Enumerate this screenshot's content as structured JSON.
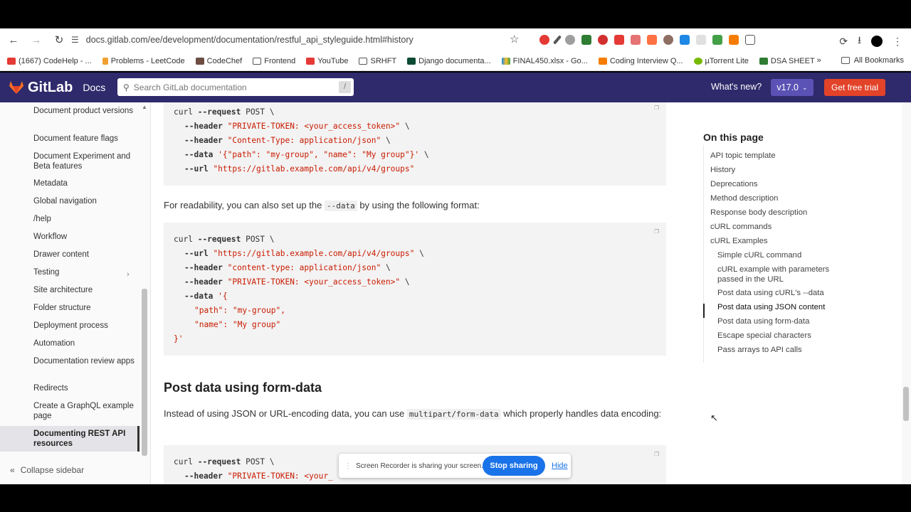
{
  "browser": {
    "url": "docs.gitlab.com/ee/development/documentation/restful_api_styleguide.html#history",
    "bookmarks": [
      "(1667) CodeHelp - ...",
      "Problems - LeetCode",
      "CodeChef",
      "Frontend",
      "YouTube",
      "SRHFT",
      "Django documenta...",
      "FINAL450.xlsx - Go...",
      "Coding Interview Q...",
      "µTorrent Lite",
      "DSA SHEET"
    ],
    "all_bookmarks": "All Bookmarks"
  },
  "header": {
    "logo_text": "GitLab",
    "docs_label": "Docs",
    "search_placeholder": "Search GitLab documentation",
    "search_shortcut": "/",
    "whats_new": "What's new?",
    "version": "v17.0",
    "trial": "Get free trial"
  },
  "sidebar": {
    "items": [
      "Document product versions",
      "Document feature flags",
      "Document Experiment and Beta features",
      "Metadata",
      "Global navigation",
      "/help",
      "Workflow",
      "Drawer content",
      "Testing",
      "Site architecture",
      "Folder structure",
      "Deployment process",
      "Automation",
      "Documentation review apps",
      "Redirects",
      "Create a GraphQL example page",
      "Documenting REST API resources"
    ],
    "collapse": "Collapse sidebar"
  },
  "content": {
    "code1": {
      "l1a": "curl",
      "l1b": "--request",
      "l1c": "POST \\",
      "l2a": "--header",
      "l2b": "\"PRIVATE-TOKEN: <your_access_token>\"",
      "l2c": "\\",
      "l3a": "--header",
      "l3b": "\"Content-Type: application/json\"",
      "l3c": "\\",
      "l4a": "--data",
      "l4b": "'{\"path\": \"my-group\", \"name\": \"My group\"}'",
      "l4c": "\\",
      "l5a": "--url",
      "l5b": "\"https://gitlab.example.com/api/v4/groups\""
    },
    "para1a": "For readability, you can also set up the",
    "para1code": "--data",
    "para1b": "by using the following format:",
    "code2": {
      "l1a": "curl",
      "l1b": "--request",
      "l1c": "POST \\",
      "l2a": "--url",
      "l2b": "\"https://gitlab.example.com/api/v4/groups\"",
      "l2c": "\\",
      "l3a": "--header",
      "l3b": "\"content-type: application/json\"",
      "l3c": "\\",
      "l4a": "--header",
      "l4b": "\"PRIVATE-TOKEN: <your_access_token>\"",
      "l4c": "\\",
      "l5a": "--data",
      "l5b": "'{",
      "l6": "\"path\": \"my-group\",",
      "l7": "\"name\": \"My group\"",
      "l8": "}'"
    },
    "heading": "Post data using form-data",
    "para2a": "Instead of using JSON or URL-encoding data, you can use",
    "para2code": "multipart/form-data",
    "para2b": "which properly handles data encoding:",
    "code3": {
      "l1a": "curl",
      "l1b": "--request",
      "l1c": "POST \\",
      "l2a": "--header",
      "l2b": "\"PRIVATE-TOKEN: <your_"
    }
  },
  "toc": {
    "title": "On this page",
    "items": [
      "API topic template",
      "History",
      "Deprecations",
      "Method description",
      "Response body description",
      "cURL commands",
      "cURL Examples",
      "Simple cURL command",
      "cURL example with parameters passed in the URL",
      "Post data using cURL's --data",
      "Post data using JSON content",
      "Post data using form-data",
      "Escape special characters",
      "Pass arrays to API calls"
    ]
  },
  "recorder": {
    "message": "Screen Recorder is sharing your screen.",
    "stop": "Stop sharing",
    "hide": "Hide"
  }
}
